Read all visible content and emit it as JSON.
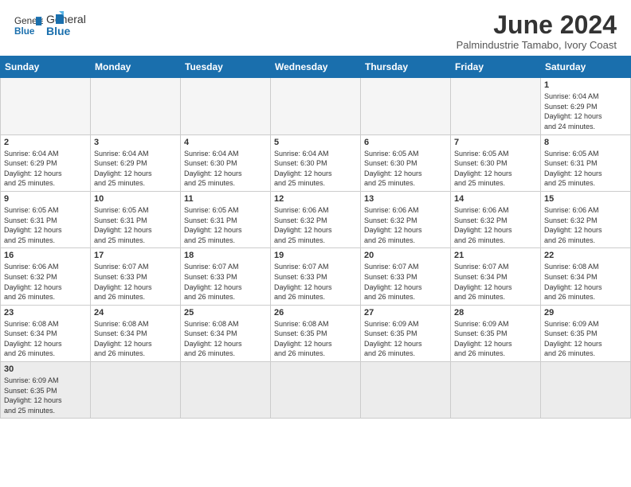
{
  "header": {
    "logo_general": "General",
    "logo_blue": "Blue",
    "month_title": "June 2024",
    "subtitle": "Palmindustrie Tamabo, Ivory Coast"
  },
  "days_of_week": [
    "Sunday",
    "Monday",
    "Tuesday",
    "Wednesday",
    "Thursday",
    "Friday",
    "Saturday"
  ],
  "weeks": [
    [
      {
        "day": "",
        "empty": true
      },
      {
        "day": "",
        "empty": true
      },
      {
        "day": "",
        "empty": true
      },
      {
        "day": "",
        "empty": true
      },
      {
        "day": "",
        "empty": true
      },
      {
        "day": "",
        "empty": true
      },
      {
        "day": "1",
        "sunrise": "6:04 AM",
        "sunset": "6:29 PM",
        "daylight": "12 hours and 24 minutes."
      }
    ],
    [
      {
        "day": "2",
        "sunrise": "6:04 AM",
        "sunset": "6:29 PM",
        "daylight": "12 hours and 25 minutes."
      },
      {
        "day": "3",
        "sunrise": "6:04 AM",
        "sunset": "6:29 PM",
        "daylight": "12 hours and 25 minutes."
      },
      {
        "day": "4",
        "sunrise": "6:04 AM",
        "sunset": "6:30 PM",
        "daylight": "12 hours and 25 minutes."
      },
      {
        "day": "5",
        "sunrise": "6:04 AM",
        "sunset": "6:30 PM",
        "daylight": "12 hours and 25 minutes."
      },
      {
        "day": "6",
        "sunrise": "6:05 AM",
        "sunset": "6:30 PM",
        "daylight": "12 hours and 25 minutes."
      },
      {
        "day": "7",
        "sunrise": "6:05 AM",
        "sunset": "6:30 PM",
        "daylight": "12 hours and 25 minutes."
      },
      {
        "day": "8",
        "sunrise": "6:05 AM",
        "sunset": "6:31 PM",
        "daylight": "12 hours and 25 minutes."
      }
    ],
    [
      {
        "day": "9",
        "sunrise": "6:05 AM",
        "sunset": "6:31 PM",
        "daylight": "12 hours and 25 minutes."
      },
      {
        "day": "10",
        "sunrise": "6:05 AM",
        "sunset": "6:31 PM",
        "daylight": "12 hours and 25 minutes."
      },
      {
        "day": "11",
        "sunrise": "6:05 AM",
        "sunset": "6:31 PM",
        "daylight": "12 hours and 25 minutes."
      },
      {
        "day": "12",
        "sunrise": "6:06 AM",
        "sunset": "6:32 PM",
        "daylight": "12 hours and 25 minutes."
      },
      {
        "day": "13",
        "sunrise": "6:06 AM",
        "sunset": "6:32 PM",
        "daylight": "12 hours and 26 minutes."
      },
      {
        "day": "14",
        "sunrise": "6:06 AM",
        "sunset": "6:32 PM",
        "daylight": "12 hours and 26 minutes."
      },
      {
        "day": "15",
        "sunrise": "6:06 AM",
        "sunset": "6:32 PM",
        "daylight": "12 hours and 26 minutes."
      }
    ],
    [
      {
        "day": "16",
        "sunrise": "6:06 AM",
        "sunset": "6:32 PM",
        "daylight": "12 hours and 26 minutes."
      },
      {
        "day": "17",
        "sunrise": "6:07 AM",
        "sunset": "6:33 PM",
        "daylight": "12 hours and 26 minutes."
      },
      {
        "day": "18",
        "sunrise": "6:07 AM",
        "sunset": "6:33 PM",
        "daylight": "12 hours and 26 minutes."
      },
      {
        "day": "19",
        "sunrise": "6:07 AM",
        "sunset": "6:33 PM",
        "daylight": "12 hours and 26 minutes."
      },
      {
        "day": "20",
        "sunrise": "6:07 AM",
        "sunset": "6:33 PM",
        "daylight": "12 hours and 26 minutes."
      },
      {
        "day": "21",
        "sunrise": "6:07 AM",
        "sunset": "6:34 PM",
        "daylight": "12 hours and 26 minutes."
      },
      {
        "day": "22",
        "sunrise": "6:08 AM",
        "sunset": "6:34 PM",
        "daylight": "12 hours and 26 minutes."
      }
    ],
    [
      {
        "day": "23",
        "sunrise": "6:08 AM",
        "sunset": "6:34 PM",
        "daylight": "12 hours and 26 minutes."
      },
      {
        "day": "24",
        "sunrise": "6:08 AM",
        "sunset": "6:34 PM",
        "daylight": "12 hours and 26 minutes."
      },
      {
        "day": "25",
        "sunrise": "6:08 AM",
        "sunset": "6:34 PM",
        "daylight": "12 hours and 26 minutes."
      },
      {
        "day": "26",
        "sunrise": "6:08 AM",
        "sunset": "6:35 PM",
        "daylight": "12 hours and 26 minutes."
      },
      {
        "day": "27",
        "sunrise": "6:09 AM",
        "sunset": "6:35 PM",
        "daylight": "12 hours and 26 minutes."
      },
      {
        "day": "28",
        "sunrise": "6:09 AM",
        "sunset": "6:35 PM",
        "daylight": "12 hours and 26 minutes."
      },
      {
        "day": "29",
        "sunrise": "6:09 AM",
        "sunset": "6:35 PM",
        "daylight": "12 hours and 26 minutes."
      }
    ],
    [
      {
        "day": "30",
        "sunrise": "6:09 AM",
        "sunset": "6:35 PM",
        "daylight": "12 hours and 25 minutes."
      },
      {
        "day": "",
        "empty": true
      },
      {
        "day": "",
        "empty": true
      },
      {
        "day": "",
        "empty": true
      },
      {
        "day": "",
        "empty": true
      },
      {
        "day": "",
        "empty": true
      },
      {
        "day": "",
        "empty": true
      }
    ]
  ],
  "labels": {
    "sunrise": "Sunrise:",
    "sunset": "Sunset:",
    "daylight": "Daylight:"
  }
}
